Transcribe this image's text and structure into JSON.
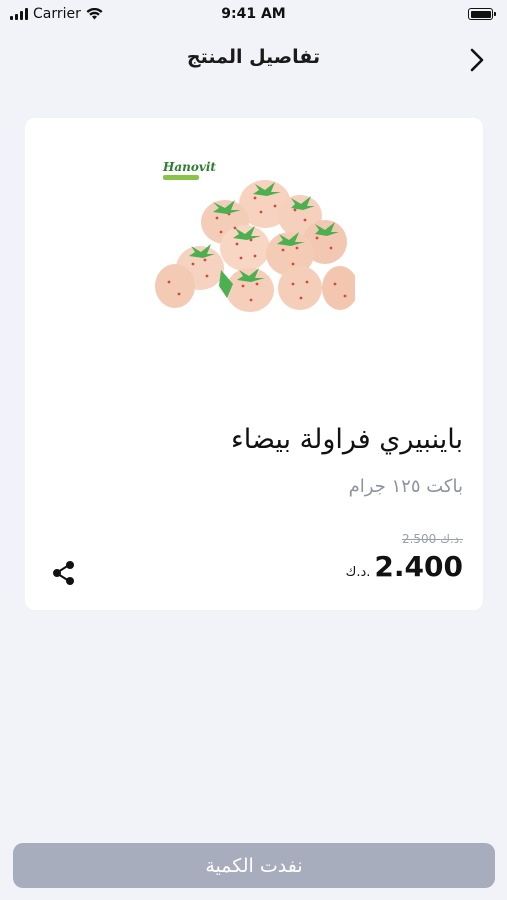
{
  "status_bar": {
    "carrier": "Carrier",
    "time": "9:41 AM"
  },
  "header": {
    "title": "تفاصيل المنتج",
    "back_icon": "chevron-right-icon"
  },
  "product": {
    "brand": "Hanovit",
    "name": "باينبيري فراولة بيضاء",
    "size": "باكت ١٢٥ جرام",
    "old_price": "2.500 د.ك.",
    "price": "2.400",
    "currency": "د.ك.",
    "share_icon": "share-icon"
  },
  "footer": {
    "button_label": "نفدت الكمية"
  },
  "colors": {
    "background": "#f1f3f8",
    "card": "#ffffff",
    "muted_text": "#8e93a0",
    "disabled_button": "#a8adbd"
  }
}
